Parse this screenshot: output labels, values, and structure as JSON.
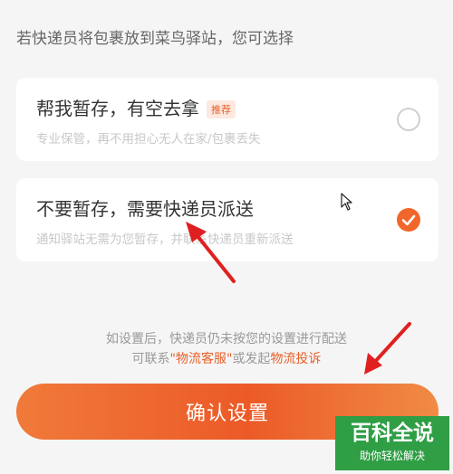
{
  "header": {
    "text": "若快递员将包裹放到菜鸟驿站，您可选择"
  },
  "options": [
    {
      "title": "帮我暂存，有空去拿",
      "badge": "推荐",
      "desc": "专业保管，再不用担心无人在家/包裹丢失",
      "selected": false
    },
    {
      "title": "不要暂存，需要快递员派送",
      "desc": "通知驿站无需为您暂存，并联系快递员重新派送",
      "selected": true
    }
  ],
  "notice": {
    "line1": "如设置后，快递员仍未按您的设置进行配送",
    "line2_prefix": "可联系",
    "link1": "\"物流客服\"",
    "line2_middle": "或发起",
    "link2": "物流投诉"
  },
  "confirm_label": "确认设置",
  "watermark": {
    "title": "百科全说",
    "subtitle": "助你轻松解决"
  },
  "colors": {
    "accent": "#f0662b",
    "watermark": "#2f9e45"
  }
}
